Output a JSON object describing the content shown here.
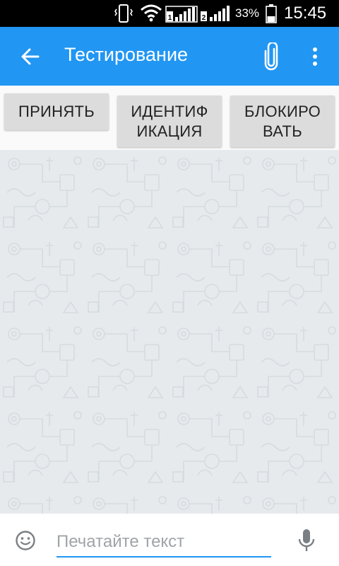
{
  "status_bar": {
    "battery_percent": "33%",
    "time": "15:45",
    "sim1_label": "1",
    "sim2_label": "2",
    "icons": [
      "vibrate-icon",
      "wifi-icon",
      "sim1-signal-icon",
      "sim2-signal-icon",
      "battery-icon"
    ]
  },
  "app_bar": {
    "title": "Тестирование",
    "icons": [
      "back-arrow-icon",
      "paperclip-icon",
      "more-vert-icon"
    ],
    "color": "#2196f3"
  },
  "actions": {
    "accept_label": "ПРИНЯТЬ",
    "identify_line1": "ИДЕНТИФ",
    "identify_line2": "ИКАЦИЯ",
    "block_line1": "БЛОКИРО",
    "block_line2": "ВАТЬ"
  },
  "composer": {
    "placeholder": "Печатайте текст",
    "value": "",
    "icons": [
      "emoji-icon",
      "mic-icon"
    ],
    "accent": "#2196f3"
  }
}
